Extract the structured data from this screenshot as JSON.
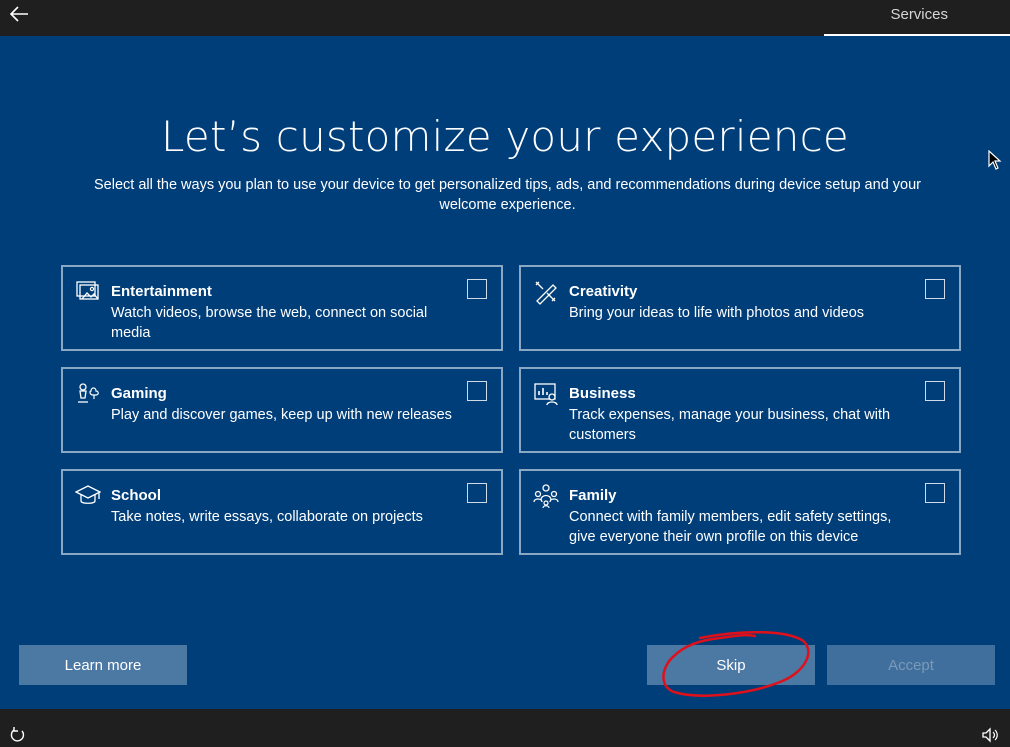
{
  "header": {
    "section_title": "Services"
  },
  "main": {
    "heading": "Let’s customize your experience",
    "subtitle": "Select all the ways you plan to use your device to get personalized tips, ads, and recommendations during device setup and your welcome experience."
  },
  "options": [
    {
      "title": "Entertainment",
      "description": "Watch videos, browse the web, connect on social media",
      "icon": "entertainment-icon",
      "checked": false
    },
    {
      "title": "Creativity",
      "description": "Bring your ideas to life with photos and videos",
      "icon": "creativity-icon",
      "checked": false
    },
    {
      "title": "Gaming",
      "description": "Play and discover games, keep up with new releases",
      "icon": "gaming-icon",
      "checked": false
    },
    {
      "title": "Business",
      "description": "Track expenses, manage your business, chat with customers",
      "icon": "business-icon",
      "checked": false
    },
    {
      "title": "School",
      "description": "Take notes, write essays, collaborate on projects",
      "icon": "school-icon",
      "checked": false
    },
    {
      "title": "Family",
      "description": "Connect with family members, edit safety settings, give everyone their own profile on this device",
      "icon": "family-icon",
      "checked": false
    }
  ],
  "buttons": {
    "learn_more": "Learn more",
    "skip": "Skip",
    "accept": "Accept"
  },
  "colors": {
    "background": "#003e7a",
    "bar": "#1f1f1f",
    "button": "#4c78a4",
    "annotation": "#e0101a"
  }
}
